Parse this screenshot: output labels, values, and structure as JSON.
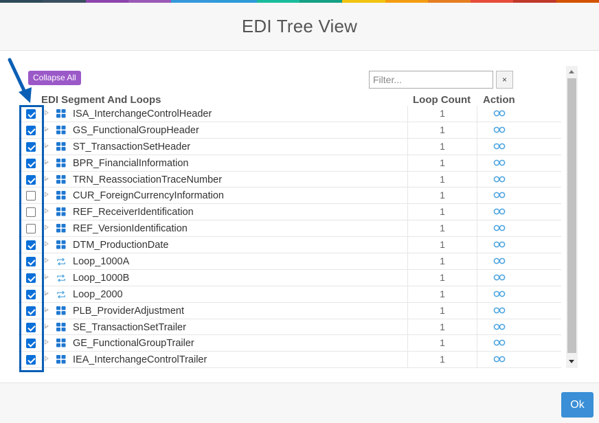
{
  "colors": {
    "top_stripes": [
      "#2f4b5a",
      "#3a4f60",
      "#8e44ad",
      "#9b59b6",
      "#3498db",
      "#2e9ad8",
      "#1abc9c",
      "#16a085",
      "#f1c40f",
      "#f39c12",
      "#e67e22",
      "#e74c3c",
      "#c0392b",
      "#d35400"
    ],
    "accent": "#0a6fd8",
    "collapse_button": "#9b59c8",
    "ok_button": "#3a8fd6"
  },
  "dialog": {
    "title": "EDI Tree View"
  },
  "toolbar": {
    "collapse_label": "Collapse All",
    "filter_placeholder": "Filter...",
    "clear_label": "×"
  },
  "columns": {
    "name": "EDI Segment And Loops",
    "count": "Loop Count",
    "action": "Action"
  },
  "rows": [
    {
      "checked": true,
      "type": "segment",
      "name": "ISA_InterchangeControlHeader",
      "count": "1"
    },
    {
      "checked": true,
      "type": "segment",
      "name": "GS_FunctionalGroupHeader",
      "count": "1"
    },
    {
      "checked": true,
      "type": "segment",
      "name": "ST_TransactionSetHeader",
      "count": "1"
    },
    {
      "checked": true,
      "type": "segment",
      "name": "BPR_FinancialInformation",
      "count": "1"
    },
    {
      "checked": true,
      "type": "segment",
      "name": "TRN_ReassociationTraceNumber",
      "count": "1"
    },
    {
      "checked": false,
      "type": "segment",
      "name": "CUR_ForeignCurrencyInformation",
      "count": "1"
    },
    {
      "checked": false,
      "type": "segment",
      "name": "REF_ReceiverIdentification",
      "count": "1"
    },
    {
      "checked": false,
      "type": "segment",
      "name": "REF_VersionIdentification",
      "count": "1"
    },
    {
      "checked": true,
      "type": "segment",
      "name": "DTM_ProductionDate",
      "count": "1"
    },
    {
      "checked": true,
      "type": "loop",
      "name": "Loop_1000A",
      "count": "1"
    },
    {
      "checked": true,
      "type": "loop",
      "name": "Loop_1000B",
      "count": "1"
    },
    {
      "checked": true,
      "type": "loop",
      "name": "Loop_2000",
      "count": "1"
    },
    {
      "checked": true,
      "type": "segment",
      "name": "PLB_ProviderAdjustment",
      "count": "1"
    },
    {
      "checked": true,
      "type": "segment",
      "name": "SE_TransactionSetTrailer",
      "count": "1"
    },
    {
      "checked": true,
      "type": "segment",
      "name": "GE_FunctionalGroupTrailer",
      "count": "1"
    },
    {
      "checked": true,
      "type": "segment",
      "name": "IEA_InterchangeControlTrailer",
      "count": "1"
    }
  ],
  "icons": {
    "segment": "grid-icon",
    "loop": "loop-icon",
    "action": "link-icon",
    "expander": "caret-right-icon"
  },
  "footer": {
    "ok_label": "Ok"
  }
}
